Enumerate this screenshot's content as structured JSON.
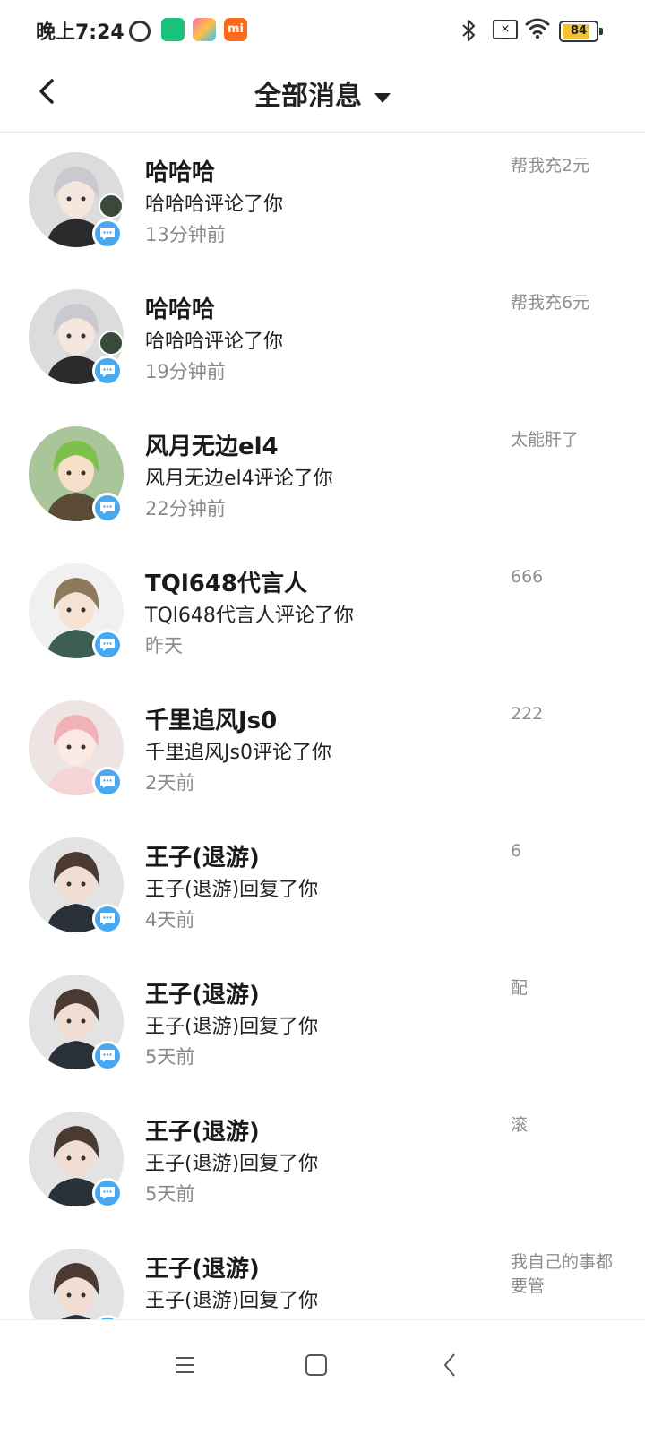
{
  "status_bar": {
    "time": "晚上7:24",
    "app3_label": "mi",
    "battery_level": 84,
    "battery_text": "84",
    "icons": [
      "alarm-icon",
      "app-icon",
      "game-center-icon",
      "mi-store-icon",
      "bluetooth-icon",
      "no-sim-icon",
      "wifi-icon",
      "battery-icon"
    ]
  },
  "header": {
    "title": "全部消息",
    "back_icon": "chevron-left-icon",
    "filter_icon": "caret-down-icon"
  },
  "messages": [
    {
      "name": "哈哈哈",
      "action": "哈哈哈评论了你",
      "time": "13分钟前",
      "preview": "帮我充2元",
      "avatar": "silver-hair-girl"
    },
    {
      "name": "哈哈哈",
      "action": "哈哈哈评论了你",
      "time": "19分钟前",
      "preview": "帮我充6元",
      "avatar": "silver-hair-girl"
    },
    {
      "name": "风月无边el4",
      "action": "风月无边el4评论了你",
      "time": "22分钟前",
      "preview": "太能肝了",
      "avatar": "green-hair-girl"
    },
    {
      "name": "TQl648代言人",
      "action": "TQl648代言人评论了你",
      "time": "昨天",
      "preview": "666",
      "avatar": "hooded-boy"
    },
    {
      "name": "千里追风Js0",
      "action": "千里追风Js0评论了你",
      "time": "2天前",
      "preview": "222",
      "avatar": "pink-hair-girl"
    },
    {
      "name": "王子(退游)",
      "action": "王子(退游)回复了你",
      "time": "4天前",
      "preview": "6",
      "avatar": "brown-hair-man"
    },
    {
      "name": "王子(退游)",
      "action": "王子(退游)回复了你",
      "time": "5天前",
      "preview": "配",
      "avatar": "brown-hair-man"
    },
    {
      "name": "王子(退游)",
      "action": "王子(退游)回复了你",
      "time": "5天前",
      "preview": "滚",
      "avatar": "brown-hair-man"
    },
    {
      "name": "王子(退游)",
      "action": "王子(退游)回复了你",
      "time": "",
      "preview": "我自己的事都要管",
      "avatar": "brown-hair-man"
    }
  ],
  "colors": {
    "badge_blue": "#4aa8f0",
    "secondary_text": "#8a8a8a",
    "battery_fill": "#f1c232"
  },
  "nav_bar": {
    "icons": [
      "menu-icon",
      "home-square-icon",
      "back-triangle-icon"
    ]
  }
}
